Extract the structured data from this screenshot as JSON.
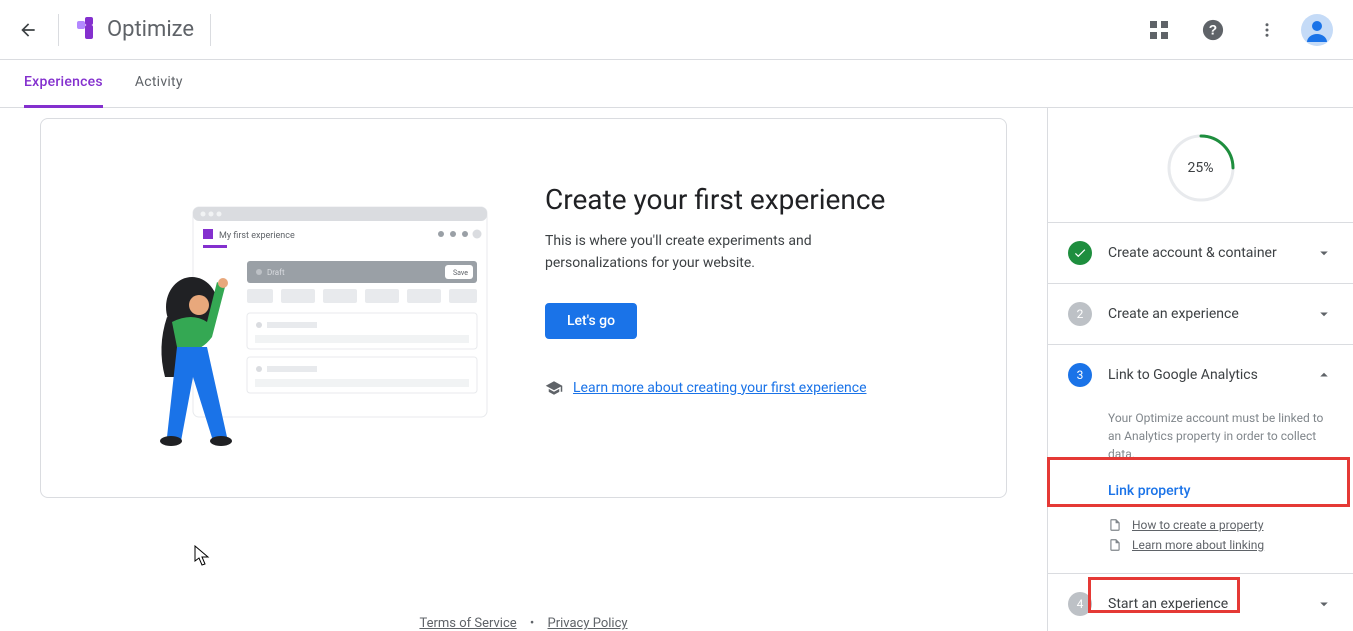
{
  "header": {
    "title": "Optimize"
  },
  "tabs": {
    "experiences": "Experiences",
    "activity": "Activity"
  },
  "hero": {
    "title": "Create your first experience",
    "subtitle": "This is where you'll create experiments and personalizations for your website.",
    "cta": "Let's go",
    "learn_link": "Learn more about creating your first experience"
  },
  "illustration": {
    "mini_title": "My first experience",
    "mini_draft": "Draft",
    "mini_save": "Save"
  },
  "sidebar": {
    "progress_pct": "25%",
    "steps": {
      "s1": {
        "title": "Create account & container"
      },
      "s2": {
        "num": "2",
        "title": "Create an experience"
      },
      "s3": {
        "num": "3",
        "title": "Link to Google Analytics",
        "desc": "Your Optimize account must be linked to an Analytics property in order to collect data.",
        "action": "Link property",
        "help1": "How to create a property",
        "help2": "Learn more about linking"
      },
      "s4": {
        "num": "4",
        "title": "Start an experience"
      }
    }
  },
  "footer": {
    "terms": "Terms of Service",
    "privacy": "Privacy Policy"
  }
}
